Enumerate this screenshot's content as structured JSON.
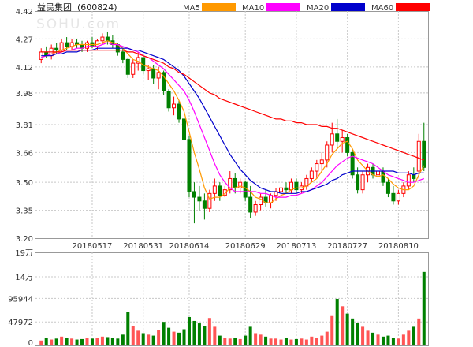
{
  "header": {
    "title": "益民集团",
    "code": "(600824)",
    "legend": [
      {
        "label": "MA5",
        "color": "#ff9900"
      },
      {
        "label": "MA10",
        "color": "#ff00ff"
      },
      {
        "label": "MA20",
        "color": "#0000cc"
      },
      {
        "label": "MA60",
        "color": "#ff0000"
      }
    ],
    "watermark": "SOHU.com"
  },
  "colors": {
    "up": "#ff0000",
    "down": "#008000",
    "grid": "#c8c8c8",
    "ma5": "#ff9900",
    "ma10": "#ff00ff",
    "ma20": "#0000cc",
    "ma60": "#ff0000"
  },
  "chart_data": [
    {
      "type": "candlestick",
      "y_ticks": [
        "4.42",
        "4.27",
        "4.12",
        "3.98",
        "3.81",
        "3.66",
        "3.50",
        "3.35",
        "3.20"
      ],
      "y_tick_values": [
        4.42,
        4.27,
        4.12,
        3.98,
        3.81,
        3.66,
        3.5,
        3.35,
        3.2
      ],
      "ylim": [
        3.2,
        4.42
      ],
      "x_tick_labels": [
        {
          "label": "20180517",
          "index": 10
        },
        {
          "label": "20180531",
          "index": 20
        },
        {
          "label": "20180614",
          "index": 29
        },
        {
          "label": "20180629",
          "index": 40
        },
        {
          "label": "20180713",
          "index": 50
        },
        {
          "label": "20180727",
          "index": 60
        },
        {
          "label": "20180810",
          "index": 70
        }
      ],
      "ohlc": [
        [
          4.16,
          4.22,
          4.14,
          4.2
        ],
        [
          4.2,
          4.23,
          4.17,
          4.18
        ],
        [
          4.18,
          4.24,
          4.16,
          4.22
        ],
        [
          4.22,
          4.25,
          4.19,
          4.21
        ],
        [
          4.21,
          4.27,
          4.2,
          4.25
        ],
        [
          4.25,
          4.28,
          4.21,
          4.23
        ],
        [
          4.23,
          4.27,
          4.21,
          4.25
        ],
        [
          4.25,
          4.27,
          4.22,
          4.24
        ],
        [
          4.24,
          4.26,
          4.2,
          4.22
        ],
        [
          4.22,
          4.26,
          4.2,
          4.25
        ],
        [
          4.25,
          4.28,
          4.22,
          4.23
        ],
        [
          4.23,
          4.27,
          4.21,
          4.26
        ],
        [
          4.26,
          4.3,
          4.24,
          4.28
        ],
        [
          4.28,
          4.31,
          4.24,
          4.26
        ],
        [
          4.26,
          4.29,
          4.22,
          4.24
        ],
        [
          4.24,
          4.25,
          4.18,
          4.2
        ],
        [
          4.2,
          4.22,
          4.14,
          4.16
        ],
        [
          4.16,
          4.17,
          4.06,
          4.08
        ],
        [
          4.08,
          4.16,
          4.06,
          4.14
        ],
        [
          4.14,
          4.2,
          4.1,
          4.17
        ],
        [
          4.17,
          4.19,
          4.08,
          4.1
        ],
        [
          4.1,
          4.13,
          4.05,
          4.11
        ],
        [
          4.11,
          4.13,
          4.03,
          4.06
        ],
        [
          4.06,
          4.12,
          4.0,
          4.09
        ],
        [
          4.09,
          4.1,
          3.97,
          3.99
        ],
        [
          3.99,
          4.0,
          3.88,
          3.9
        ],
        [
          3.9,
          3.96,
          3.86,
          3.92
        ],
        [
          3.92,
          3.94,
          3.82,
          3.84
        ],
        [
          3.84,
          3.87,
          3.71,
          3.73
        ],
        [
          3.73,
          3.75,
          3.42,
          3.45
        ],
        [
          3.45,
          3.5,
          3.28,
          3.42
        ],
        [
          3.42,
          3.48,
          3.35,
          3.4
        ],
        [
          3.4,
          3.44,
          3.3,
          3.36
        ],
        [
          3.36,
          3.46,
          3.34,
          3.44
        ],
        [
          3.44,
          3.52,
          3.4,
          3.48
        ],
        [
          3.48,
          3.5,
          3.4,
          3.43
        ],
        [
          3.43,
          3.48,
          3.42,
          3.46
        ],
        [
          3.46,
          3.56,
          3.44,
          3.52
        ],
        [
          3.52,
          3.55,
          3.44,
          3.47
        ],
        [
          3.47,
          3.52,
          3.44,
          3.5
        ],
        [
          3.5,
          3.51,
          3.4,
          3.42
        ],
        [
          3.42,
          3.48,
          3.31,
          3.34
        ],
        [
          3.34,
          3.4,
          3.32,
          3.38
        ],
        [
          3.38,
          3.44,
          3.35,
          3.42
        ],
        [
          3.42,
          3.46,
          3.37,
          3.39
        ],
        [
          3.39,
          3.44,
          3.36,
          3.43
        ],
        [
          3.43,
          3.47,
          3.4,
          3.45
        ],
        [
          3.45,
          3.48,
          3.42,
          3.47
        ],
        [
          3.47,
          3.5,
          3.44,
          3.46
        ],
        [
          3.46,
          3.52,
          3.44,
          3.5
        ],
        [
          3.5,
          3.52,
          3.44,
          3.46
        ],
        [
          3.46,
          3.5,
          3.44,
          3.48
        ],
        [
          3.48,
          3.54,
          3.46,
          3.52
        ],
        [
          3.52,
          3.58,
          3.5,
          3.56
        ],
        [
          3.56,
          3.62,
          3.52,
          3.6
        ],
        [
          3.6,
          3.66,
          3.56,
          3.62
        ],
        [
          3.62,
          3.72,
          3.58,
          3.7
        ],
        [
          3.7,
          3.82,
          3.66,
          3.76
        ],
        [
          3.76,
          3.84,
          3.68,
          3.72
        ],
        [
          3.72,
          3.78,
          3.66,
          3.74
        ],
        [
          3.74,
          3.76,
          3.64,
          3.66
        ],
        [
          3.66,
          3.68,
          3.52,
          3.54
        ],
        [
          3.54,
          3.58,
          3.44,
          3.46
        ],
        [
          3.46,
          3.56,
          3.44,
          3.54
        ],
        [
          3.54,
          3.6,
          3.5,
          3.58
        ],
        [
          3.58,
          3.6,
          3.52,
          3.54
        ],
        [
          3.54,
          3.58,
          3.5,
          3.56
        ],
        [
          3.56,
          3.58,
          3.48,
          3.5
        ],
        [
          3.5,
          3.52,
          3.42,
          3.44
        ],
        [
          3.44,
          3.48,
          3.38,
          3.4
        ],
        [
          3.4,
          3.46,
          3.38,
          3.44
        ],
        [
          3.44,
          3.5,
          3.42,
          3.48
        ],
        [
          3.48,
          3.56,
          3.46,
          3.54
        ],
        [
          3.54,
          3.58,
          3.5,
          3.52
        ],
        [
          3.56,
          3.76,
          3.52,
          3.72
        ],
        [
          3.72,
          3.82,
          3.56,
          3.58
        ]
      ],
      "ma5": [
        4.17,
        4.18,
        4.19,
        4.2,
        4.21,
        4.22,
        4.23,
        4.24,
        4.24,
        4.24,
        4.24,
        4.24,
        4.25,
        4.26,
        4.25,
        4.24,
        4.22,
        4.19,
        4.16,
        4.15,
        4.13,
        4.12,
        4.11,
        4.1,
        4.07,
        4.03,
        3.99,
        3.94,
        3.88,
        3.77,
        3.66,
        3.57,
        3.47,
        3.41,
        3.42,
        3.42,
        3.44,
        3.47,
        3.47,
        3.48,
        3.47,
        3.45,
        3.42,
        3.41,
        3.39,
        3.39,
        3.41,
        3.43,
        3.44,
        3.46,
        3.47,
        3.47,
        3.48,
        3.5,
        3.52,
        3.56,
        3.6,
        3.65,
        3.68,
        3.71,
        3.72,
        3.68,
        3.62,
        3.59,
        3.56,
        3.54,
        3.53,
        3.54,
        3.52,
        3.49,
        3.47,
        3.46,
        3.46,
        3.48,
        3.54,
        3.59
      ],
      "ma10": [
        4.17,
        4.18,
        4.19,
        4.19,
        4.2,
        4.21,
        4.21,
        4.22,
        4.22,
        4.23,
        4.23,
        4.23,
        4.24,
        4.25,
        4.24,
        4.24,
        4.23,
        4.22,
        4.21,
        4.2,
        4.18,
        4.17,
        4.15,
        4.13,
        4.11,
        4.08,
        4.05,
        4.02,
        3.99,
        3.94,
        3.88,
        3.81,
        3.74,
        3.67,
        3.6,
        3.54,
        3.5,
        3.47,
        3.45,
        3.45,
        3.45,
        3.45,
        3.45,
        3.44,
        3.44,
        3.43,
        3.42,
        3.42,
        3.42,
        3.43,
        3.43,
        3.44,
        3.45,
        3.46,
        3.48,
        3.5,
        3.53,
        3.56,
        3.59,
        3.61,
        3.63,
        3.64,
        3.63,
        3.62,
        3.61,
        3.6,
        3.58,
        3.56,
        3.54,
        3.53,
        3.52,
        3.51,
        3.5,
        3.5,
        3.51,
        3.52
      ],
      "ma20": [
        4.18,
        4.18,
        4.18,
        4.19,
        4.19,
        4.2,
        4.2,
        4.2,
        4.21,
        4.21,
        4.21,
        4.22,
        4.22,
        4.22,
        4.22,
        4.22,
        4.22,
        4.22,
        4.21,
        4.21,
        4.2,
        4.19,
        4.18,
        4.17,
        4.16,
        4.14,
        4.12,
        4.1,
        4.07,
        4.03,
        3.99,
        3.95,
        3.9,
        3.85,
        3.8,
        3.75,
        3.7,
        3.65,
        3.61,
        3.57,
        3.54,
        3.51,
        3.49,
        3.47,
        3.46,
        3.45,
        3.45,
        3.44,
        3.44,
        3.44,
        3.44,
        3.45,
        3.45,
        3.46,
        3.47,
        3.48,
        3.49,
        3.51,
        3.52,
        3.54,
        3.55,
        3.56,
        3.56,
        3.56,
        3.56,
        3.56,
        3.56,
        3.56,
        3.56,
        3.56,
        3.55,
        3.55,
        3.55,
        3.54,
        3.55,
        3.55
      ],
      "ma60": [
        4.2,
        4.2,
        4.2,
        4.2,
        4.2,
        4.21,
        4.21,
        4.21,
        4.21,
        4.21,
        4.21,
        4.21,
        4.21,
        4.21,
        4.21,
        4.21,
        4.21,
        4.2,
        4.2,
        4.19,
        4.18,
        4.17,
        4.16,
        4.15,
        4.14,
        4.12,
        4.11,
        4.09,
        4.08,
        4.06,
        4.04,
        4.02,
        4.0,
        3.98,
        3.97,
        3.95,
        3.94,
        3.93,
        3.92,
        3.91,
        3.9,
        3.89,
        3.88,
        3.87,
        3.86,
        3.85,
        3.84,
        3.84,
        3.83,
        3.83,
        3.82,
        3.82,
        3.81,
        3.81,
        3.81,
        3.8,
        3.8,
        3.79,
        3.79,
        3.78,
        3.77,
        3.76,
        3.75,
        3.74,
        3.73,
        3.72,
        3.71,
        3.7,
        3.69,
        3.68,
        3.67,
        3.66,
        3.65,
        3.64,
        3.63,
        3.62
      ]
    },
    {
      "type": "bar",
      "name": "volume",
      "y_ticks": [
        "19万",
        "14万",
        "95944",
        "47972",
        "0"
      ],
      "y_tick_values": [
        190000,
        140000,
        95944,
        47972,
        0
      ],
      "ylim": [
        0,
        190000
      ],
      "values": [
        10000,
        15000,
        12000,
        14000,
        18000,
        16000,
        14000,
        12000,
        13000,
        15000,
        14000,
        16000,
        18000,
        17000,
        16000,
        14000,
        22000,
        68000,
        40000,
        30000,
        25000,
        22000,
        20000,
        32000,
        48000,
        36000,
        28000,
        26000,
        33000,
        58000,
        50000,
        45000,
        40000,
        56000,
        38000,
        20000,
        15000,
        14000,
        16000,
        13000,
        20000,
        38000,
        25000,
        22000,
        18000,
        14000,
        14000,
        12000,
        15000,
        12000,
        13000,
        14000,
        12000,
        18000,
        15000,
        20000,
        28000,
        60000,
        95000,
        80000,
        65000,
        55000,
        46000,
        38000,
        30000,
        26000,
        22000,
        18000,
        20000,
        16000,
        14000,
        22000,
        30000,
        38000,
        55000,
        150000
      ],
      "colors_up_down": "ohlc"
    }
  ]
}
